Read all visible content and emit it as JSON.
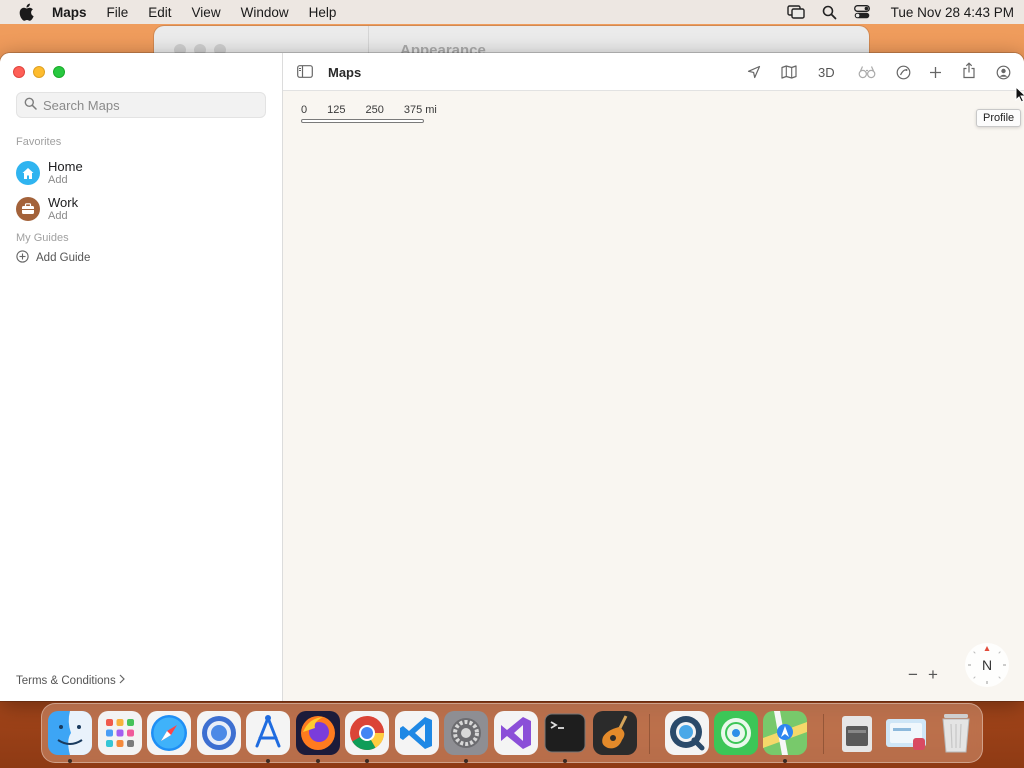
{
  "menubar": {
    "app_name": "Maps",
    "items": [
      "File",
      "Edit",
      "View",
      "Window",
      "Help"
    ],
    "clock": "Tue Nov 28  4:43 PM"
  },
  "background_window": {
    "title": "Appearance"
  },
  "sidebar": {
    "search_placeholder": "Search Maps",
    "favorites_label": "Favorites",
    "favorites": [
      {
        "name": "Home",
        "sub": "Add",
        "icon": "house-icon",
        "color": "#2fb4f0"
      },
      {
        "name": "Work",
        "sub": "Add",
        "icon": "briefcase-icon",
        "color": "#a3623a"
      }
    ],
    "guides_label": "My Guides",
    "add_guide": "Add Guide",
    "terms": "Terms & Conditions"
  },
  "toolbar": {
    "title": "Maps",
    "three_d": "3D",
    "buttons": [
      "current-location-icon",
      "map-mode-icon",
      "3d-button",
      "look-around-icon",
      "traffic-icon",
      "add-icon",
      "share-icon",
      "profile-icon"
    ]
  },
  "map": {
    "scale_labels": [
      "0",
      "125",
      "250",
      "375 mi"
    ],
    "tooltip": "Profile",
    "compass_label": "N",
    "zoom_out": "−",
    "zoom_in": "+"
  },
  "dock": {
    "apps": [
      "finder",
      "launchpad",
      "safari",
      "chrome-canary",
      "app-store",
      "firefox",
      "chrome",
      "vscode",
      "system-settings",
      "visual-studio",
      "terminal",
      "garageband",
      "quicktime",
      "find-my",
      "maps",
      "file-manager",
      "preview",
      "trash"
    ]
  }
}
